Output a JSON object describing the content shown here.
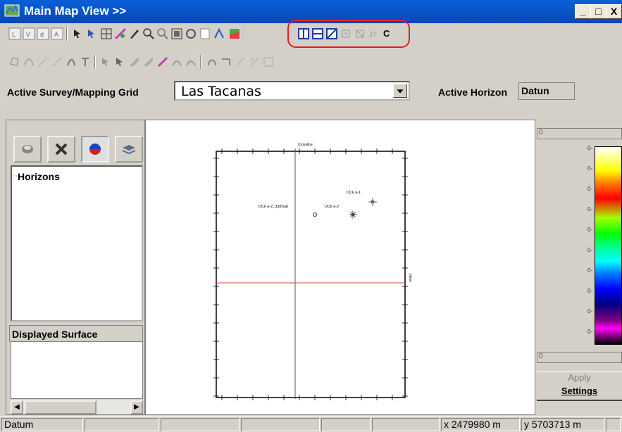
{
  "window": {
    "title": "Main Map View >>",
    "minimize": "_",
    "maximize": "□",
    "close": "X"
  },
  "toolbar": {
    "row1_icons": [
      "select-icon",
      "move-icon",
      "grid-icon",
      "measure-icon",
      "draw-icon",
      "zoom-in-icon",
      "zoom-out-icon",
      "zoom-box-icon",
      "rotate-icon",
      "info-icon",
      "well-icon",
      "surface-icon"
    ],
    "row1_highlighted_icons": [
      "split-vertical-icon",
      "split-horizontal-icon",
      "pane-icon",
      "grid-small-icon",
      "section-icon",
      "rescale-icon"
    ],
    "row1_highlighted_text": "C",
    "row2_icons": [
      "polygon-icon",
      "curve-icon",
      "line-icon",
      "pen-icon",
      "edit-icon",
      "fault-icon",
      "pick-icon",
      "pick2-icon"
    ],
    "highlight_color": "#e02020"
  },
  "grid_row": {
    "survey_label": "Active Survey/Mapping Grid",
    "survey_value": "Las Tacanas",
    "horizon_label": "Active Horizon",
    "horizon_value": "Datun"
  },
  "left_panel": {
    "tree_item": "Horizons",
    "surface_label": "Displayed Surface"
  },
  "map": {
    "top_label": "Crossline",
    "right_label": "Inline",
    "wells": [
      {
        "name": "DCk a-2_338Sub"
      },
      {
        "name": "DCk a-2"
      },
      {
        "name": "DCk a-1"
      }
    ]
  },
  "right_panel": {
    "top_value": "0",
    "bottom_value": "0",
    "apply": "Apply",
    "settings": "Settings",
    "tick_labels": [
      "0",
      "0",
      "0",
      "0",
      "0",
      "0",
      "0",
      "0",
      "0",
      "0"
    ]
  },
  "status": {
    "horizon": "Datum",
    "x": "x 2479980 m",
    "y": "y 5703713 m"
  }
}
